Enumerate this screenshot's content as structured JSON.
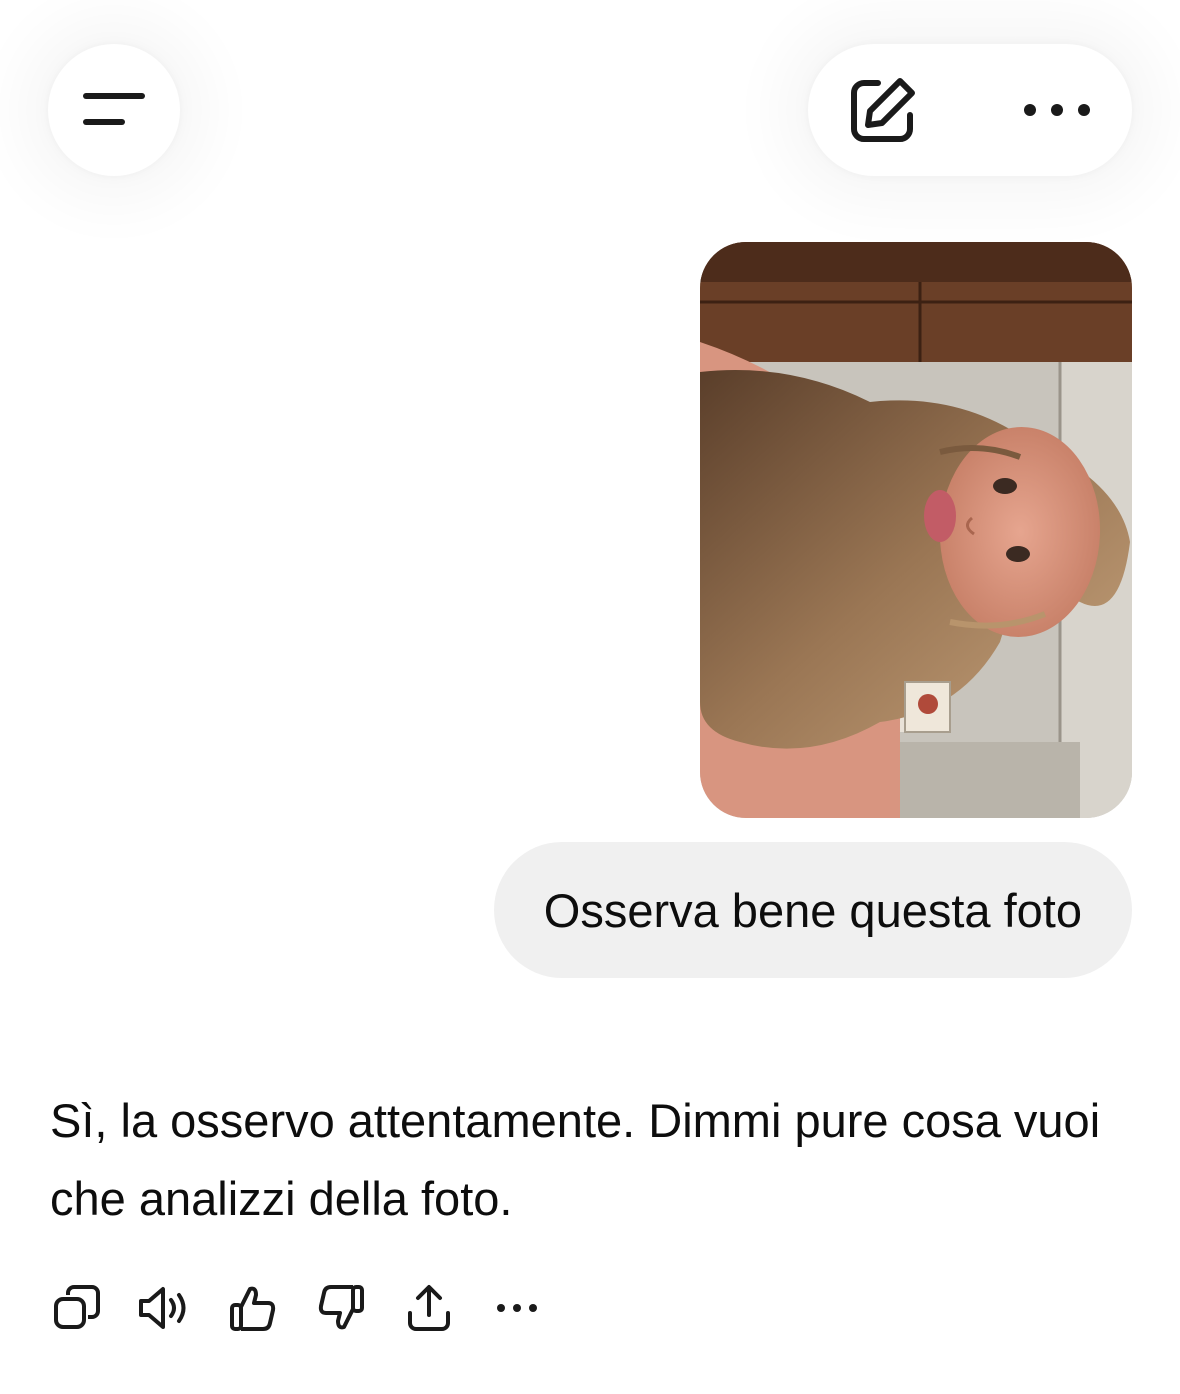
{
  "header": {
    "menu_icon": "menu-icon",
    "new_chat_icon": "edit-square-icon",
    "more_icon": "more-horizontal-icon"
  },
  "conversation": {
    "user_image": {
      "kind": "photo",
      "orientation": "rotated"
    },
    "user_message": "Osserva bene questa foto",
    "assistant_message": "Sì, la osservo attentamente. Dimmi pure cosa vuoi che analizzi della foto."
  },
  "message_actions": [
    {
      "icon": "copy-icon"
    },
    {
      "icon": "speaker-icon"
    },
    {
      "icon": "thumbs-up-icon"
    },
    {
      "icon": "thumbs-down-icon"
    },
    {
      "icon": "share-icon"
    },
    {
      "icon": "more-horizontal-icon"
    }
  ],
  "colors": {
    "background": "#ffffff",
    "bubble": "#f0f0f0",
    "text": "#0d0d0d",
    "icon": "#1a1a1a"
  }
}
